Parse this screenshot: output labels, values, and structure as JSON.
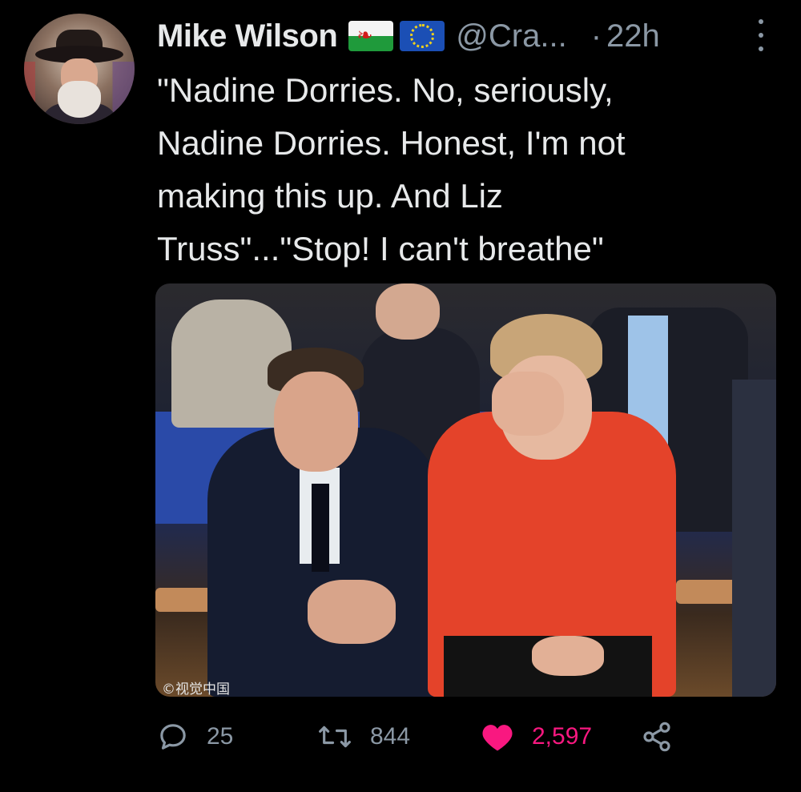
{
  "tweet": {
    "author": {
      "display_name": "Mike Wilson",
      "flags": [
        "wales-flag",
        "eu-flag"
      ],
      "handle": "@Cra...",
      "separator": "·",
      "time": "22h"
    },
    "text_lines": [
      "\"Nadine Dorries. No, seriously,",
      "Nadine Dorries. Honest, I'm not",
      "making this up. And Liz",
      "Truss\"...\"Stop! I can't breathe\""
    ],
    "media": {
      "watermark": "©视觉中国"
    },
    "actions": {
      "reply_count": "25",
      "retweet_count": "844",
      "like_count": "2,597"
    },
    "colors": {
      "background": "#000000",
      "text": "#e7e9ea",
      "secondary": "#8b98a5",
      "like": "#f91880"
    }
  }
}
